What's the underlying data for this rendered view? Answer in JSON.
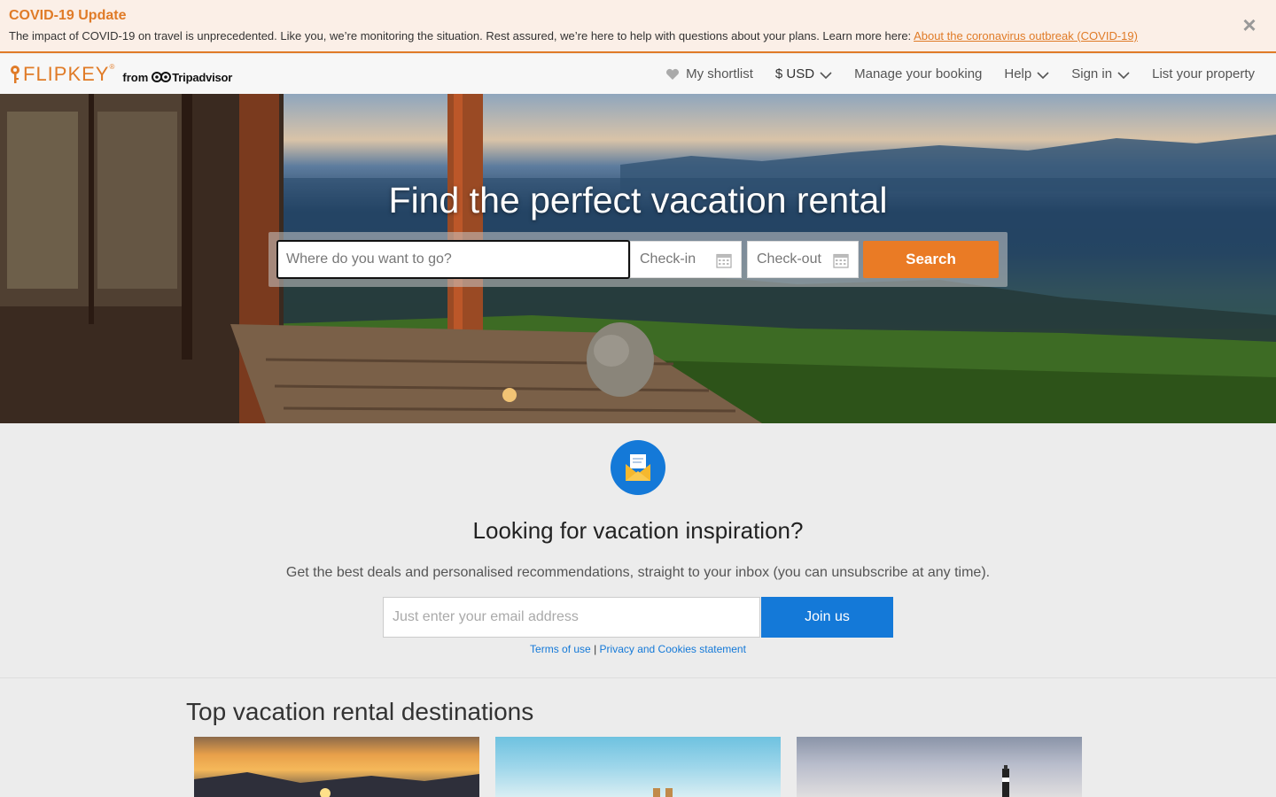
{
  "covid_banner": {
    "title": "COVID-19 Update",
    "text": "The impact of COVID-19 on travel is unprecedented. Like you, we’re monitoring the situation. Rest assured, we’re here to help with questions about your plans. Learn more here: ",
    "link_text": "About the coronavirus outbreak (COVID-19)",
    "close_icon": "×"
  },
  "header": {
    "logo": {
      "brand": "FLIPKEY",
      "registered": "®",
      "from": "from",
      "partner": "Tripadvisor"
    },
    "nav": {
      "shortlist": "My shortlist",
      "currency": "$ USD",
      "manage_booking": "Manage your booking",
      "help": "Help",
      "sign_in": "Sign in",
      "list_property": "List your property"
    }
  },
  "hero": {
    "title": "Find the perfect vacation rental",
    "search": {
      "destination_placeholder": "Where do you want to go?",
      "checkin_label": "Check-in",
      "checkout_label": "Check-out",
      "search_label": "Search"
    }
  },
  "newsletter": {
    "title": "Looking for vacation inspiration?",
    "subtitle": "Get the best deals and personalised recommendations, straight to your inbox (you can unsubscribe at any time).",
    "email_placeholder": "Just enter your email address",
    "join_label": "Join us",
    "terms_label": "Terms of use",
    "separator": " | ",
    "privacy_label": "Privacy and Cookies statement"
  },
  "destinations": {
    "title": "Top vacation rental destinations"
  },
  "colors": {
    "brand_orange": "#ea7b25",
    "accent_blue": "#1479d8",
    "banner_bg": "#fbefe7"
  }
}
